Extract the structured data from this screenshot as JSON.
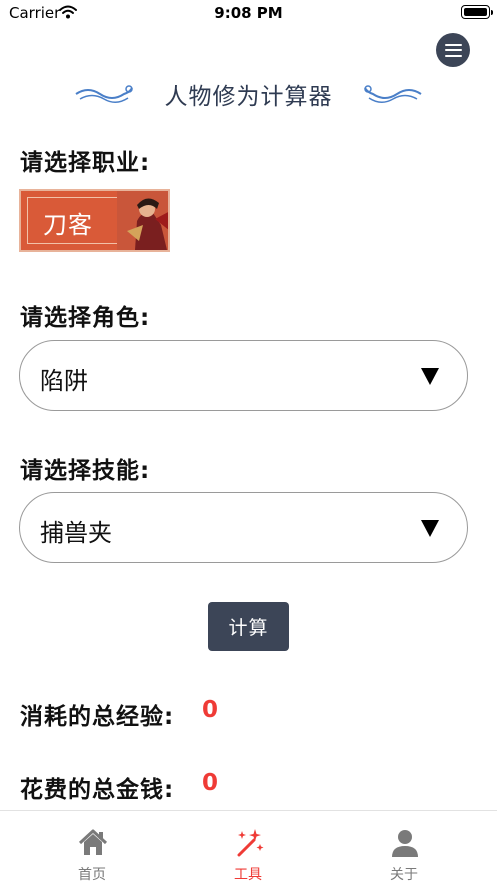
{
  "status_bar": {
    "carrier": "Carrier",
    "time": "9:08 PM"
  },
  "header": {
    "title": "人物修为计算器",
    "menu_icon": "hamburger-menu-icon"
  },
  "profession": {
    "label": "请选择职业:",
    "selected": "刀客"
  },
  "role": {
    "label": "请选择角色:",
    "value": "陷阱"
  },
  "skill": {
    "label": "请选择技能:",
    "value": "捕兽夹"
  },
  "calculate_button": "计算",
  "results": {
    "exp_label": "消耗的总经验:",
    "exp_value": "0",
    "money_label": "花费的总金钱:",
    "money_value": "0"
  },
  "tabs": [
    {
      "label": "首页",
      "icon": "home-icon",
      "active": false
    },
    {
      "label": "工具",
      "icon": "magic-wand-icon",
      "active": true
    },
    {
      "label": "关于",
      "icon": "person-icon",
      "active": false
    }
  ],
  "colors": {
    "accent": "#ef3b36",
    "primary_dark": "#3c4557",
    "tab_inactive": "#7a7a7a",
    "tab_active": "#ef3b36"
  }
}
